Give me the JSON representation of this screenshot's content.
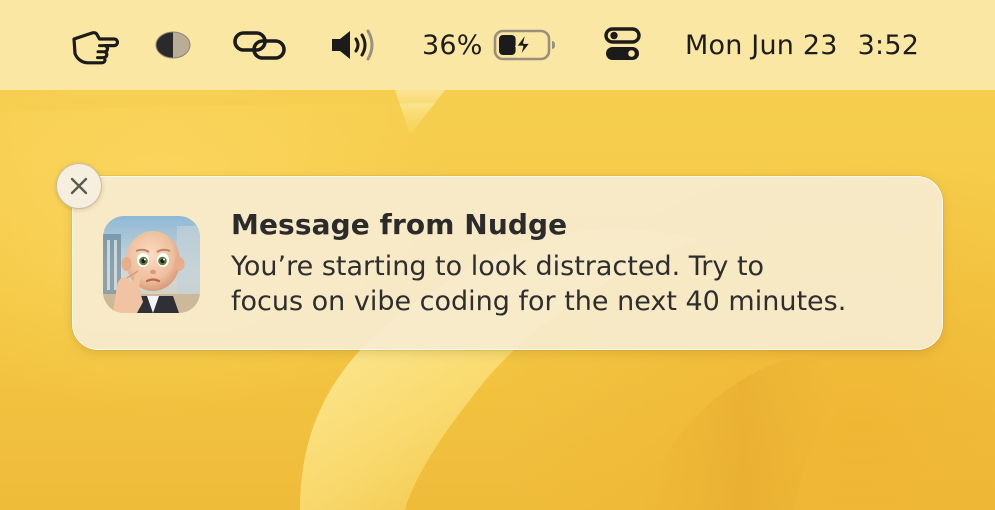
{
  "menubar": {
    "icons": {
      "pointer": "pointing-hand-icon",
      "display": "half-circle-display-icon",
      "link": "link-icon",
      "volume": "speaker-volume-icon",
      "battery": "battery-charging-icon",
      "control_center": "control-center-icon"
    },
    "battery_percent": "36%",
    "battery_level": 0.36,
    "date": "Mon Jun 23",
    "time": "3:52"
  },
  "notification": {
    "title": "Message from Nudge",
    "body_lines": [
      "You’re starting to look distracted. Try to",
      "focus on vibe coding for the next 40 minutes."
    ],
    "app_icon": "baby-face-app-icon",
    "close_icon": "close-icon"
  },
  "colors": {
    "menubar_bg": "#fbe7a4",
    "wallpaper": "#f6cf4e",
    "notification_bg": "#f7ecd0",
    "text": "#2b2b2b"
  }
}
